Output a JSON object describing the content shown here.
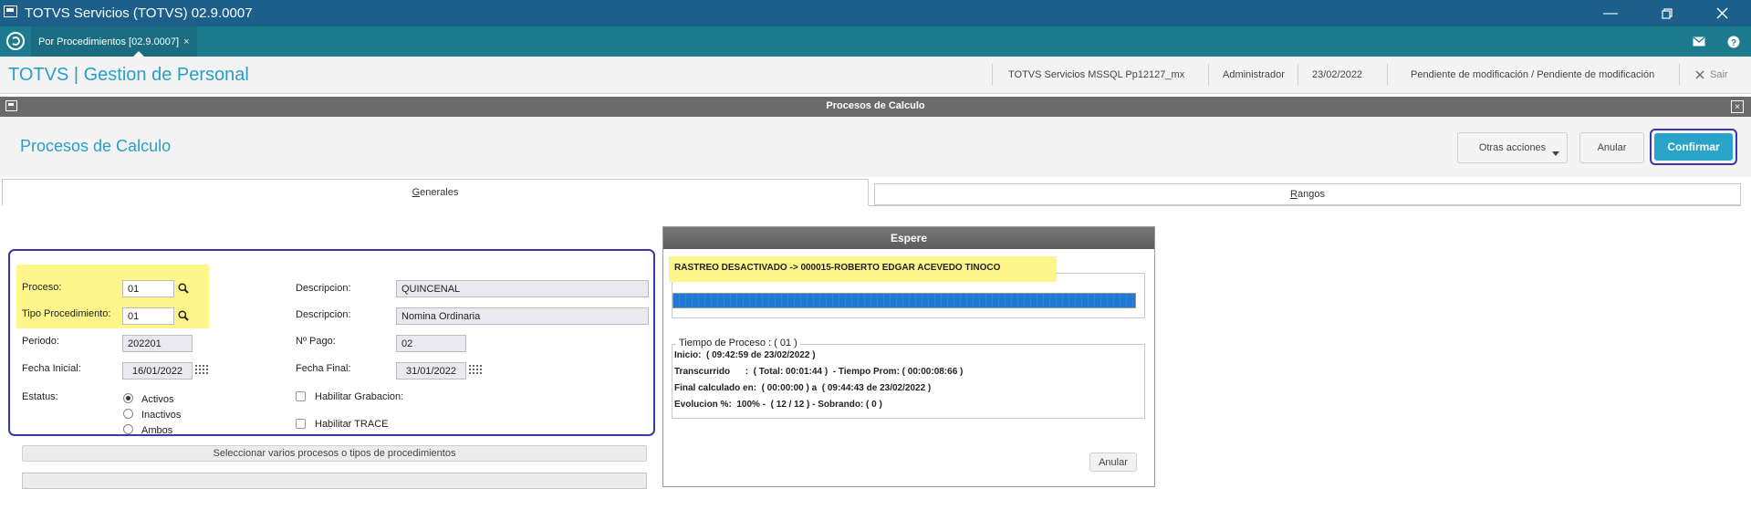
{
  "window": {
    "title": "TOTVS Servicios (TOTVS) 02.9.0007"
  },
  "tabbar": {
    "tab_label": "Por Procedimientos [02.9.0007]",
    "tab_close": "×"
  },
  "header": {
    "brand": "TOTVS | Gestion de Personal",
    "environment": "TOTVS Servicios MSSQL Pp12127_mx",
    "user": "Administrador",
    "date": "23/02/2022",
    "status": "Pendiente de modificación / Pendiente de modificación",
    "exit_label": "Sair"
  },
  "modal": {
    "title": "Procesos de Calculo"
  },
  "page": {
    "title": "Procesos de Calculo",
    "btn_other": "Otras acciones",
    "btn_cancel": "Anular",
    "btn_confirm": "Confirmar"
  },
  "tabs": {
    "general_g": "G",
    "general_rest": "enerales",
    "ranges_r": "R",
    "ranges_rest": "angos"
  },
  "form": {
    "proceso_label": "Proceso:",
    "proceso_value": "01",
    "tipo_label": "Tipo Procedimiento:",
    "tipo_value": "01",
    "periodo_label": "Periodo:",
    "periodo_value": "202201",
    "fecha_ini_label": "Fecha Inicial:",
    "fecha_ini_value": "16/01/2022",
    "estatus_label": "Estatus:",
    "desc1_label": "Descripcion:",
    "desc1_value": "QUINCENAL",
    "desc2_label": "Descripcion:",
    "desc2_value": "Nomina Ordinaria",
    "npago_label": "Nº Pago:",
    "npago_value": "02",
    "fecha_fin_label": "Fecha Final:",
    "fecha_fin_value": "31/01/2022",
    "radio_activos": "Activos",
    "radio_inactivos": "Inactivos",
    "radio_ambos": "Ambos",
    "chk_grab": "Habilitar Grabacion:",
    "chk_trace": "Habilitar TRACE",
    "select_btn": "Seleccionar varios procesos o tipos de procedimientos"
  },
  "wait": {
    "title": "Espere",
    "trace": "RASTREO DESACTIVADO -> 000015-ROBERTO EDGAR ACEVEDO TINOCO",
    "progress": 1.0,
    "group_title": "Tiempo de Proceso : ( 01 )",
    "line1": "Inicio:  ( 09:42:59 de 23/02/2022 )",
    "line2": "Transcurrido      :  ( Total: 00:01:44 )  - Tiempo Prom: ( 00:00:08:66 )",
    "line3": "Final calculado en:  ( 00:00:00 ) a  ( 09:44:43 de 23/02/2022 )",
    "line4": "Evolucion %:  100% -  ( 12 / 12 ) - Sobrando: ( 0 )",
    "cancel": "Anular"
  },
  "colors": {
    "accent": "#2aa3c8",
    "titlebar": "#1b5f8a",
    "tabbar": "#1d7b8f",
    "highlight": "#fdf68a",
    "outline": "#3a37a8",
    "progress": "#1f78d1"
  }
}
